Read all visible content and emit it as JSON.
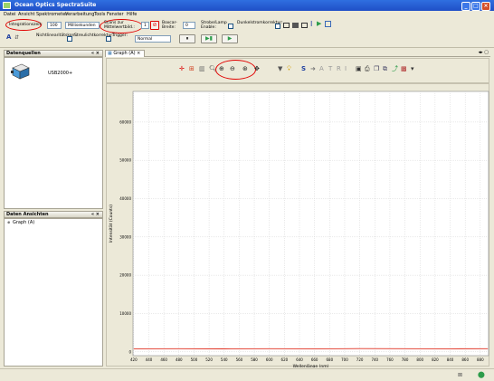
{
  "window": {
    "title": "Ocean Optics SpectraSuite"
  },
  "menu": [
    "Datei",
    "Ansicht",
    "Spektrometer",
    "Verarbeitung",
    "Tools",
    "Fenster",
    "Hilfe"
  ],
  "toolbar": {
    "integration_label": "Integrationszeit:",
    "integration_value": "100",
    "integration_unit": "Millisekunden",
    "scans_label": "Scans zur Mittelwertbild.:",
    "scans_value": "1",
    "boxcar_label": "Boxcar-Breite:",
    "boxcar_value": "0",
    "strobe_label": "Strobe/Lamp Enable:",
    "dark_label": "Dunkelstromkorrektur:",
    "nonlin_label": "Nichtlinearitätskorr.:",
    "stray_label": "Streulichtkorrektur:",
    "trigger_label": "Trigger:",
    "trigger_value": "Normal"
  },
  "data_sources": {
    "title": "Datenquellen",
    "device": "USB2000+"
  },
  "data_views": {
    "title": "Daten Ansichten",
    "item": "Graph (A)"
  },
  "graph": {
    "tab": "Graph (A)"
  },
  "chart_data": {
    "type": "line",
    "xlabel": "Wellenlänge (nm)",
    "ylabel": "Intensität (Counts)",
    "xlim": [
      419,
      891
    ],
    "ylim": [
      -1000,
      68000
    ],
    "x_ticks": [
      420,
      440,
      460,
      480,
      500,
      520,
      540,
      560,
      580,
      600,
      620,
      640,
      660,
      680,
      700,
      720,
      740,
      760,
      780,
      800,
      820,
      840,
      860,
      880
    ],
    "y_ticks": [
      0,
      10000,
      20000,
      30000,
      40000,
      50000,
      60000
    ],
    "grid": true,
    "series": [
      {
        "color": "#e03020",
        "x": [
          420,
          480,
          540,
          600,
          660,
          720,
          780,
          840,
          890
        ],
        "y": [
          800,
          820,
          780,
          810,
          800,
          850,
          820,
          800,
          810
        ]
      }
    ]
  }
}
